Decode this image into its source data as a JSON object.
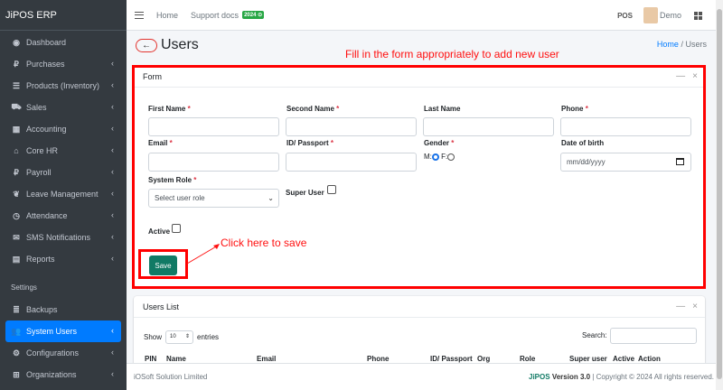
{
  "sidebar": {
    "brand": "JiPOS ERP",
    "items": [
      {
        "label": "Dashboard",
        "icon": "dashboard-icon",
        "glyph": "◉",
        "chevron": false
      },
      {
        "label": "Purchases",
        "icon": "ruble-icon",
        "glyph": "₽",
        "chevron": true
      },
      {
        "label": "Products (Inventory)",
        "icon": "list-icon",
        "glyph": "☰",
        "chevron": true
      },
      {
        "label": "Sales",
        "icon": "cart-icon",
        "glyph": "⛟",
        "chevron": true
      },
      {
        "label": "Accounting",
        "icon": "calculator-icon",
        "glyph": "▦",
        "chevron": true
      },
      {
        "label": "Core HR",
        "icon": "bank-icon",
        "glyph": "⌂",
        "chevron": true
      },
      {
        "label": "Payroll",
        "icon": "ruble-icon",
        "glyph": "₽",
        "chevron": true
      },
      {
        "label": "Leave Management",
        "icon": "leaf-icon",
        "glyph": "❦",
        "chevron": true
      },
      {
        "label": "Attendance",
        "icon": "clock-icon",
        "glyph": "◷",
        "chevron": true
      },
      {
        "label": "SMS Notifications",
        "icon": "sms-icon",
        "glyph": "✉",
        "chevron": true
      },
      {
        "label": "Reports",
        "icon": "file-icon",
        "glyph": "▤",
        "chevron": true
      }
    ],
    "section_header": "Settings",
    "settings_items": [
      {
        "label": "Backups",
        "icon": "database-icon",
        "glyph": "≣",
        "chevron": false
      },
      {
        "label": "System Users",
        "icon": "users-icon",
        "glyph": "👥",
        "chevron": true,
        "active": true
      },
      {
        "label": "Configurations",
        "icon": "gear-icon",
        "glyph": "⚙",
        "chevron": true
      },
      {
        "label": "Organizations",
        "icon": "sitemap-icon",
        "glyph": "⊞",
        "chevron": true
      }
    ]
  },
  "topbar": {
    "home": "Home",
    "support": "Support docs",
    "badge": "2024",
    "pos": "POS",
    "user": "Demo"
  },
  "page": {
    "title": "Users",
    "breadcrumb_home": "Home",
    "breadcrumb_sep": "/",
    "breadcrumb_current": "Users"
  },
  "annotations": {
    "fill_form": "Fill in the form appropriately to add new user",
    "click_save": "Click here to save"
  },
  "form": {
    "header": "Form",
    "first_name": "First Name",
    "second_name": "Second Name",
    "last_name": "Last Name",
    "phone": "Phone",
    "email": "Email",
    "id_passport": "ID/ Passport",
    "gender": "Gender",
    "gender_m": "M:",
    "gender_f": "F:",
    "dob": "Date of birth",
    "dob_placeholder": "mm/dd/yyyy",
    "system_role": "System Role",
    "role_placeholder": "Select user role",
    "super_user": "Super User",
    "active": "Active",
    "save": "Save",
    "required_mark": "*"
  },
  "users_list": {
    "header": "Users List",
    "show": "Show",
    "entries_value": "10",
    "entries": "entries",
    "search": "Search:",
    "columns": [
      "PIN",
      "Name",
      "Email",
      "Phone",
      "ID/ Passport",
      "Org",
      "Role",
      "Super user",
      "Active",
      "Action"
    ]
  },
  "footer": {
    "company": "iOSoft Solution Limited",
    "brand": "JiPOS",
    "version": "Version 3.0",
    "copyright": "| Copyright © 2024 All rights reserved."
  }
}
